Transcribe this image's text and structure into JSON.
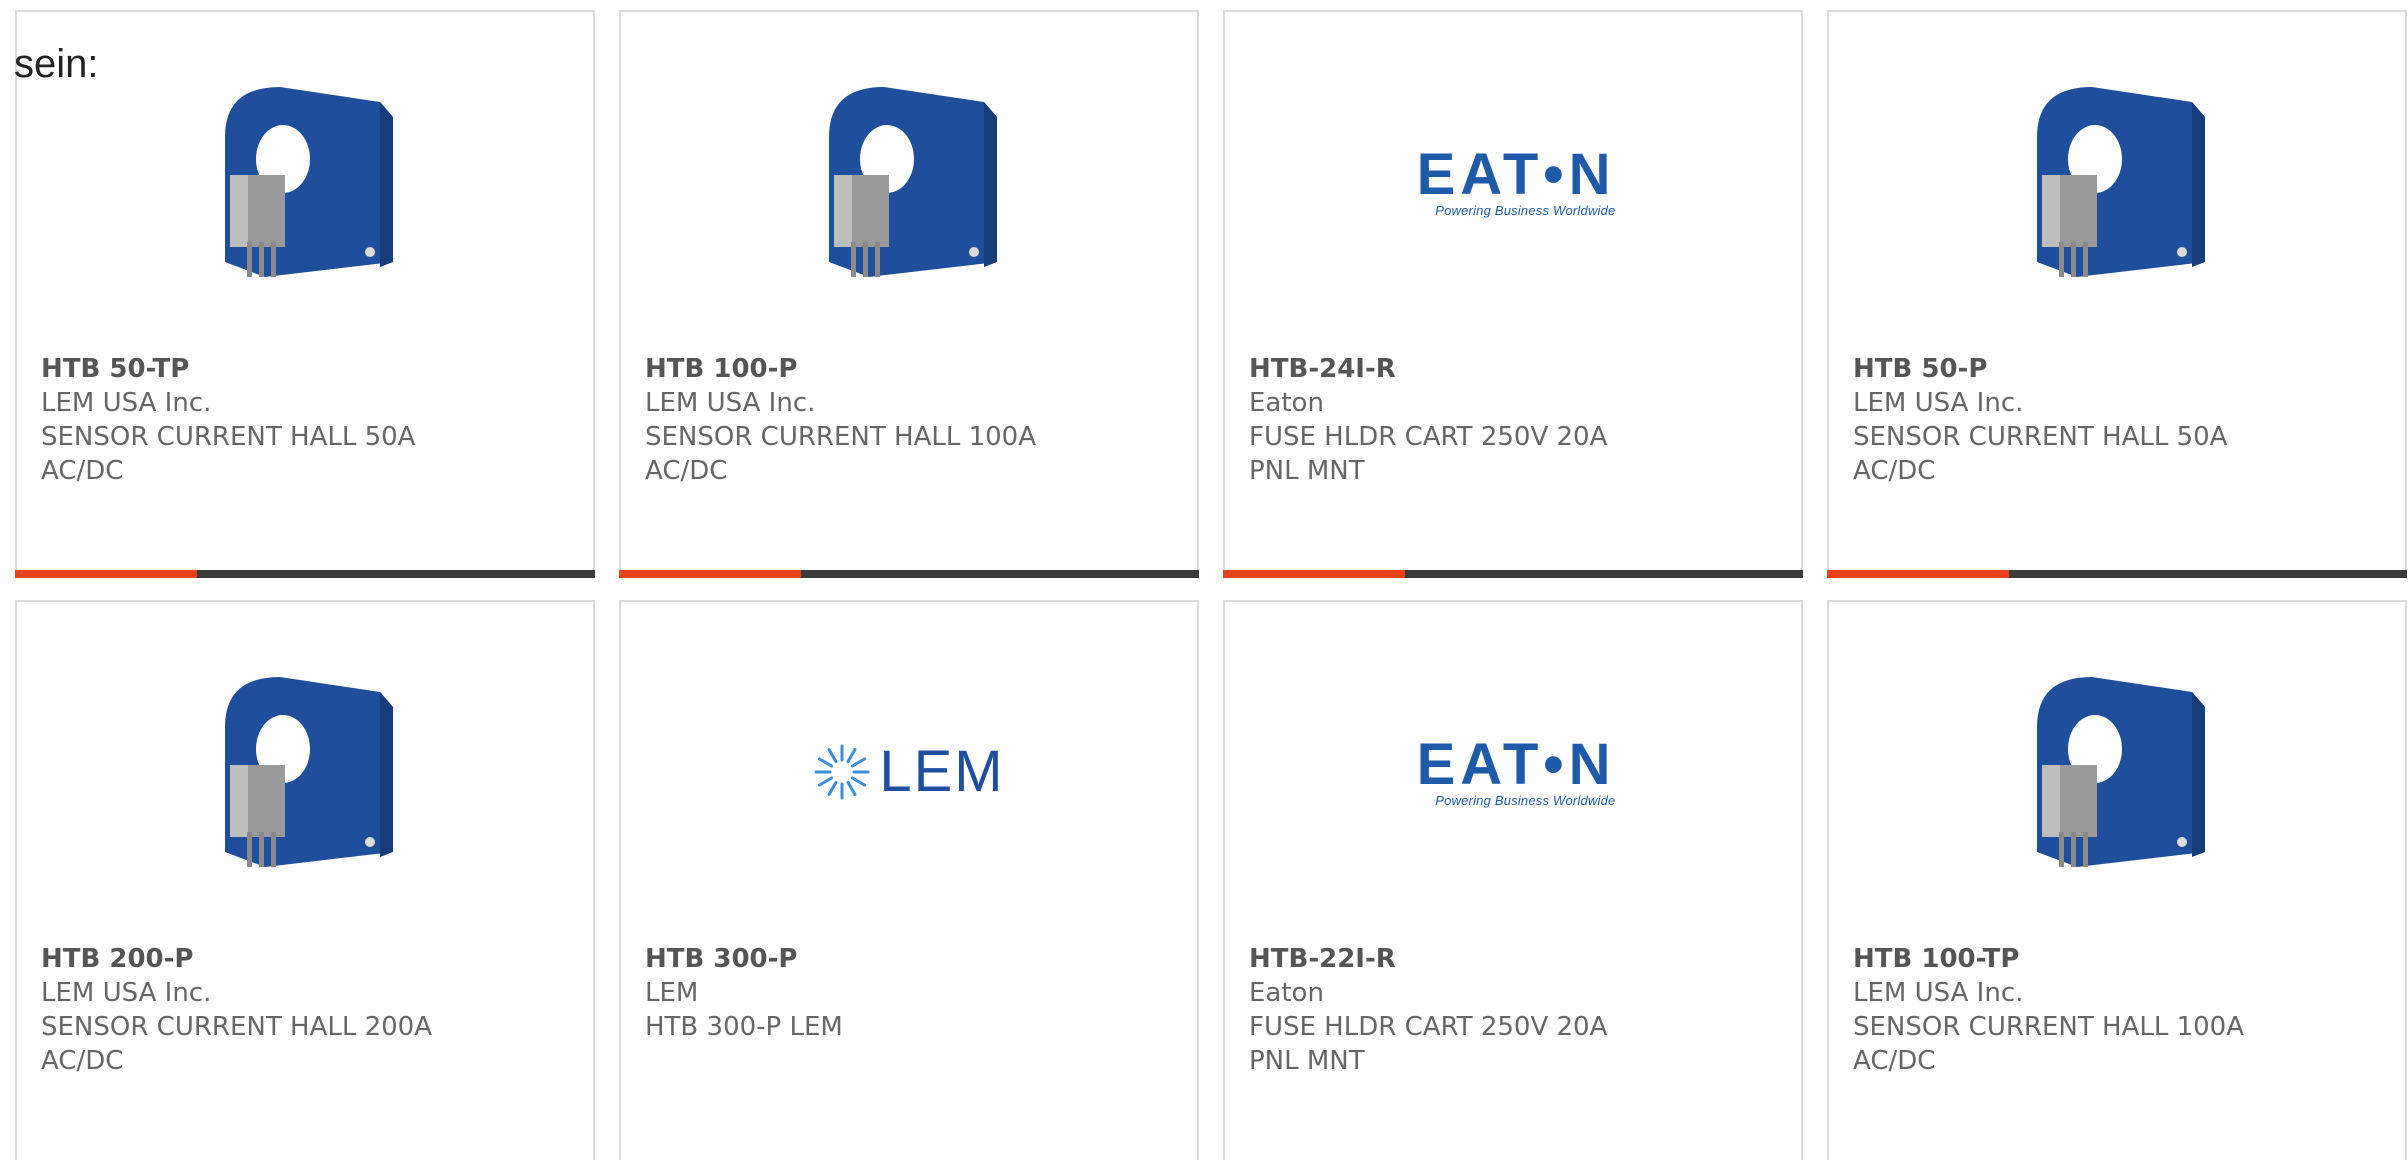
{
  "page": {
    "intro_text": "sein:"
  },
  "brand_colors": {
    "accent": "#e8421a",
    "bar_dark": "#3c3c3c",
    "sensor_blue": "#1f4f9c",
    "logo_blue": "#1f5aa8"
  },
  "products": [
    {
      "part_number": "HTB 50-TP",
      "manufacturer": "LEM USA Inc.",
      "description": "SENSOR CURRENT HALL 50A AC/DC",
      "image": "current-sensor-photo"
    },
    {
      "part_number": "HTB 100-P",
      "manufacturer": "LEM USA Inc.",
      "description": "SENSOR CURRENT HALL 100A AC/DC",
      "image": "current-sensor-photo"
    },
    {
      "part_number": "HTB-24I-R",
      "manufacturer": "Eaton",
      "description": "FUSE HLDR CART 250V 20A PNL MNT",
      "image": "eaton-logo",
      "logo": {
        "wordmark": "EAT•N",
        "tagline": "Powering Business Worldwide"
      }
    },
    {
      "part_number": "HTB 50-P",
      "manufacturer": "LEM USA Inc.",
      "description": "SENSOR CURRENT HALL 50A AC/DC",
      "image": "current-sensor-photo"
    },
    {
      "part_number": "HTB 200-P",
      "manufacturer": "LEM USA Inc.",
      "description": "SENSOR CURRENT HALL 200A AC/DC",
      "image": "current-sensor-photo"
    },
    {
      "part_number": "HTB 300-P",
      "manufacturer": "LEM",
      "description": "HTB 300-P LEM",
      "image": "lem-logo",
      "logo": {
        "wordmark": "LEM"
      }
    },
    {
      "part_number": "HTB-22I-R",
      "manufacturer": "Eaton",
      "description": "FUSE HLDR CART 250V 20A PNL MNT",
      "image": "eaton-logo",
      "logo": {
        "wordmark": "EAT•N",
        "tagline": "Powering Business Worldwide"
      }
    },
    {
      "part_number": "HTB 100-TP",
      "manufacturer": "LEM USA Inc.",
      "description": "SENSOR CURRENT HALL 100A AC/DC",
      "image": "current-sensor-photo"
    }
  ]
}
